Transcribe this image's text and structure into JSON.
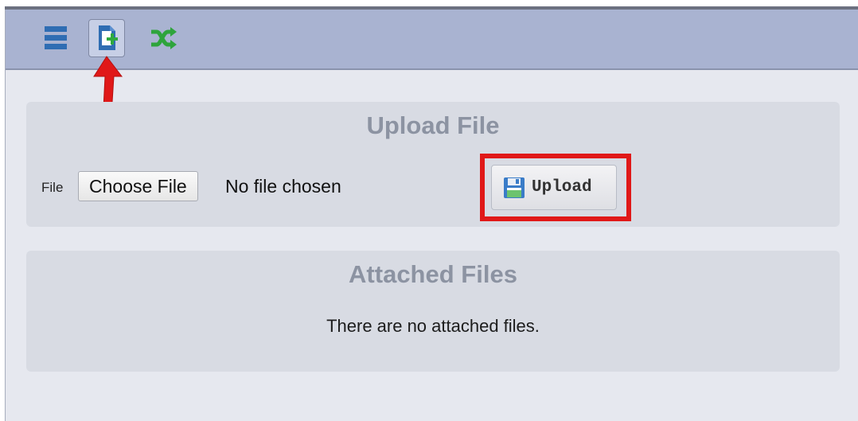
{
  "toolbar": {
    "icons": [
      "menu-icon",
      "add-file-icon",
      "shuffle-icon"
    ]
  },
  "upload_panel": {
    "title": "Upload File",
    "file_label": "File",
    "choose_button": "Choose File",
    "no_file_text": "No file chosen",
    "upload_button": "Upload"
  },
  "attached_panel": {
    "title": "Attached Files",
    "empty_message": "There are no attached files."
  },
  "colors": {
    "toolbar_bg": "#a9b3d1",
    "annotation_red": "#e01818",
    "panel_bg": "#d8dbe3"
  }
}
